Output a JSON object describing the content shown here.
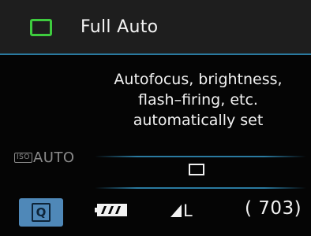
{
  "header": {
    "mode_label": "Full Auto",
    "mode_icon": "green-square-icon",
    "mode_color": "#3ecb3e"
  },
  "description": {
    "lines": [
      "Autofocus, brightness,",
      "flash–firing, etc.",
      "automatically set"
    ]
  },
  "iso": {
    "tag": "ISO",
    "value": "AUTO"
  },
  "drive_mode": {
    "icon": "single-shot-square-icon"
  },
  "status_bar": {
    "quick_button_label": "Q",
    "quick_button_color": "#4f88b8",
    "battery_icon": "battery-full-icon",
    "image_quality": "L",
    "quality_icon": "quality-fine-triangle-icon",
    "shots_remaining": "( 703)"
  },
  "colors": {
    "accent_line": "#2a7aa0",
    "background": "#050505",
    "header_background": "#1e1e1e"
  }
}
